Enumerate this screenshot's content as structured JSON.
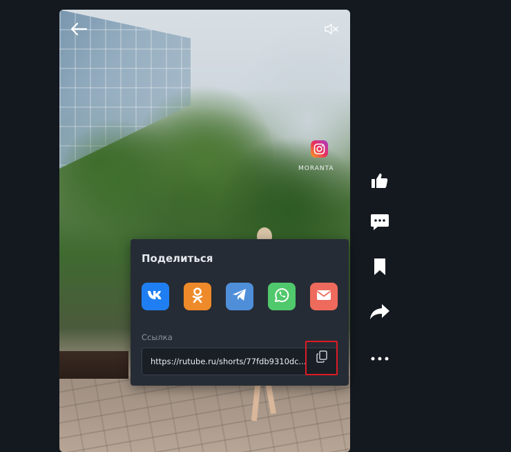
{
  "video": {
    "watermark_text": "MORANTA"
  },
  "share": {
    "title": "Поделиться",
    "networks": [
      {
        "name": "vk",
        "color": "#1f7ff2"
      },
      {
        "name": "ok",
        "color": "#ee8a29"
      },
      {
        "name": "telegram",
        "color": "#4f8fd9"
      },
      {
        "name": "whatsapp",
        "color": "#50c86c"
      },
      {
        "name": "mail",
        "color": "#ee6a5c"
      }
    ],
    "link_label": "Ссылка",
    "link_value": "https://rutube.ru/shorts/77fdb9310dc..."
  },
  "actions": {
    "icons": [
      "thumbs-up-icon",
      "comment-icon",
      "bookmark-icon",
      "share-icon",
      "more-icon"
    ]
  },
  "colors": {
    "background": "#14191f",
    "popup": "#262c35",
    "highlight": "#e01b24"
  }
}
